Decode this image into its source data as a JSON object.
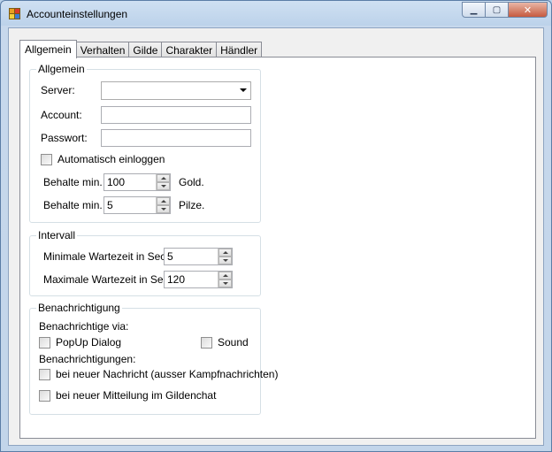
{
  "window": {
    "title": "Accounteinstellungen",
    "buttons": {
      "minimize": "▁",
      "maximize": "▢",
      "close": "✕"
    }
  },
  "tabs": [
    "Allgemein",
    "Verhalten",
    "Gilde",
    "Charakter",
    "Händler"
  ],
  "active_tab": "Allgemein",
  "groups": {
    "allgemein": {
      "title": "Allgemein",
      "server_label": "Server:",
      "server_value": "",
      "account_label": "Account:",
      "account_value": "",
      "password_label": "Passwort:",
      "password_value": "",
      "autologin_label": "Automatisch einloggen",
      "gold_prefix": "Behalte min.",
      "gold_value": "100",
      "gold_suffix": "Gold.",
      "pilze_prefix": "Behalte min.",
      "pilze_value": "5",
      "pilze_suffix": "Pilze."
    },
    "intervall": {
      "title": "Intervall",
      "min_label": "Minimale Wartezeit in Sec.:",
      "min_value": "5",
      "max_label": "Maximale Wartezeit in Sec.:",
      "max_value": "120"
    },
    "benachrichtigung": {
      "title": "Benachrichtigung",
      "via_label": "Benachrichtige via:",
      "popup_label": "PopUp Dialog",
      "sound_label": "Sound",
      "events_label": "Benachrichtigungen:",
      "new_message_label": "bei neuer Nachricht (ausser Kampfnachrichten)",
      "guild_chat_label": "bei neuer Mitteilung im Gildenchat"
    }
  },
  "icons": {
    "app": "app-window-icon",
    "combo": "chevron-down-icon",
    "spin_up": "spin-up-icon",
    "spin_down": "spin-down-icon"
  },
  "colors": {
    "app_icon_orange": "#e8a020",
    "app_icon_red": "#d83a2a",
    "app_icon_yellow": "#f2d23c",
    "app_icon_blue": "#3b7bd4",
    "close_button": "#c65a3e"
  }
}
